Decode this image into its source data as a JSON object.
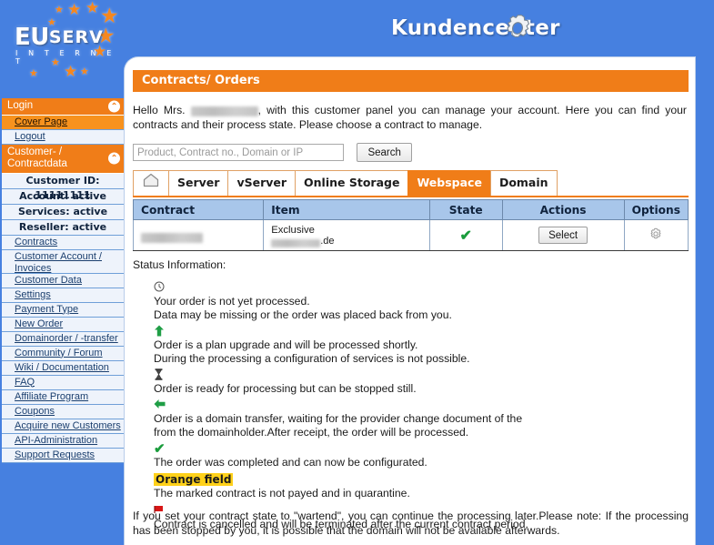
{
  "banner": {
    "title": "Kundencenter",
    "gear_icon": "gear-icon",
    "logo": {
      "word_eu": "EU",
      "word_serv": "SERV",
      "subtitle": "I N T E R N E T"
    }
  },
  "sidebar": {
    "sections": [
      {
        "header": "Login",
        "collapse_icon": "collapse-up-icon",
        "items": [
          {
            "label": "Cover Page",
            "active": true
          },
          {
            "label": "Logout",
            "active": false
          }
        ]
      },
      {
        "header": "Customer- / Contractdata",
        "collapse_icon": "collapse-up-icon",
        "info": [
          "Customer ID: 11111111",
          "Account: active",
          "Services: active",
          "Reseller: active"
        ],
        "items": [
          {
            "label": "Contracts",
            "active": false
          },
          {
            "label": "Customer Account / Invoices",
            "active": false
          },
          {
            "label": "Customer Data",
            "active": false
          },
          {
            "label": "Settings",
            "active": false
          },
          {
            "label": "Payment Type",
            "active": false
          },
          {
            "label": "New Order",
            "active": false
          },
          {
            "label": "Domainorder / -transfer",
            "active": false
          },
          {
            "label": "Community / Forum",
            "active": false
          },
          {
            "label": "Wiki / Documentation",
            "active": false
          },
          {
            "label": "FAQ",
            "active": false
          },
          {
            "label": "Affiliate Program",
            "active": false
          },
          {
            "label": "Coupons",
            "active": false
          },
          {
            "label": "Acquire new Customers",
            "active": false
          },
          {
            "label": "API-Administration",
            "active": false
          },
          {
            "label": "Support Requests",
            "active": false
          }
        ]
      }
    ]
  },
  "main": {
    "page_title": "Contracts/ Orders",
    "intro_before": "Hello Mrs. ",
    "intro_name_redacted": "█████████",
    "intro_after": ", with this customer panel you can manage your account. Here you can find your contracts and their process state. Please choose a contract to manage.",
    "search": {
      "placeholder": "Product, Contract no., Domain or IP",
      "value": "",
      "button_label": "Search"
    },
    "tabs": [
      {
        "label": "",
        "icon": "home-icon",
        "active": false
      },
      {
        "label": "Server",
        "active": false
      },
      {
        "label": "vServer",
        "active": false
      },
      {
        "label": "Online Storage",
        "active": false
      },
      {
        "label": "Webspace",
        "active": true
      },
      {
        "label": "Domain",
        "active": false
      }
    ],
    "table": {
      "columns": [
        "Contract",
        "Item",
        "State",
        "Actions",
        "Options"
      ],
      "rows": [
        {
          "contract": "██████████",
          "item_product": "Exclusive",
          "item_domain_redacted": "████████",
          "item_domain_suffix": ".de",
          "state_icon": "green-check-icon",
          "action_label": "Select",
          "options_icon": "gear-icon"
        }
      ]
    },
    "status_information_label": "Status Information:",
    "legend": [
      {
        "icon": "clock-icon",
        "lines": [
          "Your order is not yet processed.",
          "Data may be missing or the order was placed back from you."
        ]
      },
      {
        "icon": "green-up-arrow-icon",
        "lines": [
          "Order is a plan upgrade and will be processed shortly.",
          "During the processing a configuration of services is not possible."
        ]
      },
      {
        "icon": "hourglass-icon",
        "lines": [
          "Order is ready for processing but can be stopped still."
        ]
      },
      {
        "icon": "green-left-arrow-icon",
        "lines": [
          "Order is a domain transfer, waiting for the provider change document of the",
          "from the domainholder.After receipt, the order will be processed."
        ]
      },
      {
        "icon": "green-check-icon",
        "lines": [
          "The order was completed and can now be configurated."
        ]
      },
      {
        "icon": "orange-field-badge",
        "badge": "Orange field",
        "lines": [
          "The marked contract is not payed and in quarantine."
        ]
      },
      {
        "icon": "red-flag-icon",
        "lines": [
          "Contract is cancelled and will be terminated after the current contract period."
        ]
      }
    ],
    "footnote": "If you set your contract state to \"wartend\", you can continue the processing later.Please note: If the processing has been stopped by you, it is possible that the domain will not be available afterwards."
  },
  "colors": {
    "brand_blue": "#4680e0",
    "brand_orange": "#f07d18",
    "table_header_blue": "#a8c6ea",
    "sidebar_item_bg": "#eef3fb",
    "highlight_yellow": "#ffd11a",
    "success_green": "#1a9c3c",
    "cancel_red": "#d81616"
  }
}
